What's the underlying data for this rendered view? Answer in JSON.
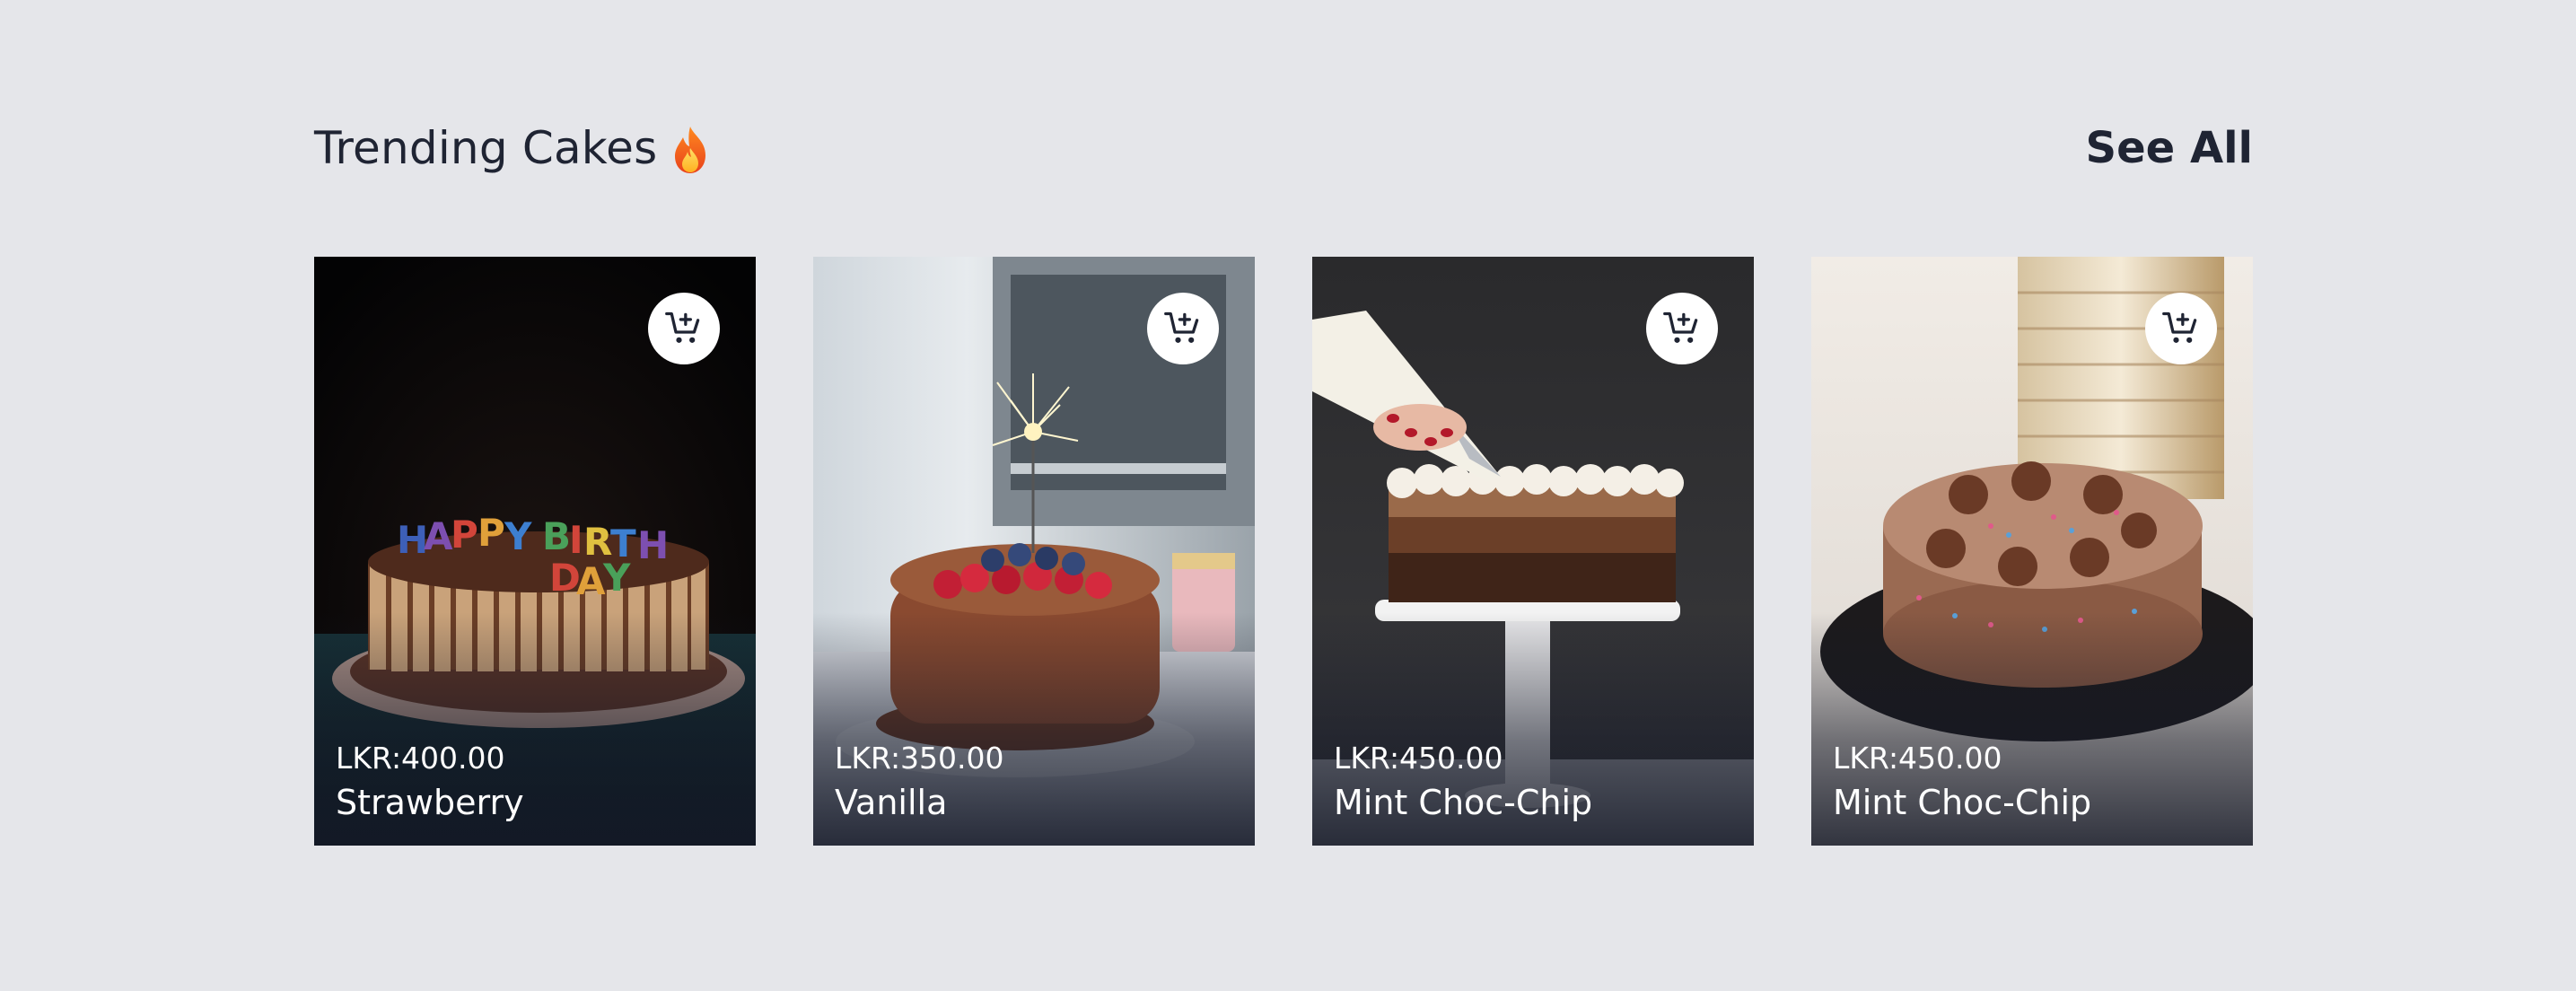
{
  "header": {
    "title": "Trending Cakes",
    "title_icon": "fire-icon",
    "see_all_label": "See All"
  },
  "cards": [
    {
      "price": "LKR:400.00",
      "name": "Strawberry",
      "image": "birthday-cake-photo",
      "cart_icon": "add-to-cart-icon"
    },
    {
      "price": "LKR:350.00",
      "name": "Vanilla",
      "image": "sparkler-berry-cake-photo",
      "cart_icon": "add-to-cart-icon"
    },
    {
      "price": "LKR:450.00",
      "name": "Mint Choc-Chip",
      "image": "piping-ombre-cake-photo",
      "cart_icon": "add-to-cart-icon"
    },
    {
      "price": "LKR:450.00",
      "name": "Mint Choc-Chip",
      "image": "chocolate-swirl-cake-photo",
      "cart_icon": "add-to-cart-icon"
    }
  ],
  "colors": {
    "background": "#e5e6ea",
    "text": "#1f2433",
    "card_text": "#ffffff",
    "cart_button_bg": "#ffffff"
  }
}
